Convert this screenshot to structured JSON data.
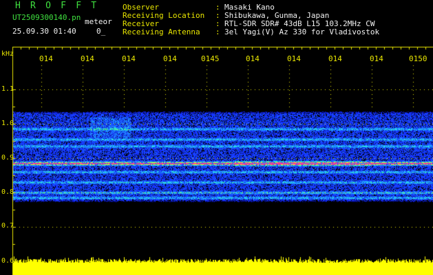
{
  "header": {
    "title": "H R O F F T",
    "file": "UT2509300140.pn",
    "meteor_label": "meteor",
    "date": "25.09.30 01:40",
    "count": "0_",
    "info": [
      {
        "label": "Observer",
        "value": "Masaki Kano"
      },
      {
        "label": "Receiving Location",
        "value": "Shibukawa, Gunma, Japan"
      },
      {
        "label": "Receiver",
        "value": "RTL-SDR SDR# 43dB L15 103.2MHz CW"
      },
      {
        "label": "Receiving Antenna",
        "value": "3el Yagi(V) Az 330 for Vladivostok"
      }
    ]
  },
  "axis": {
    "unit": "kHz",
    "y_ticks": [
      "1.1",
      "1.0",
      "0.9",
      "0.8",
      "0.7",
      "0.6"
    ],
    "x_ticks": [
      "014",
      "014",
      "014",
      "014",
      "0145",
      "014",
      "014",
      "014",
      "014",
      "0150"
    ]
  },
  "spectrogram": {
    "freq_min": 0.77,
    "freq_max": 1.04,
    "lines_khz": [
      0.985,
      0.955,
      0.935,
      0.885,
      0.86,
      0.83,
      0.8,
      0.785
    ],
    "strong_line_khz": 0.885
  },
  "colors": {
    "label": "#3fe03f",
    "text": "#f2f2f2",
    "axis": "#e9e600",
    "noise": "#1535ff",
    "strong": "#ff3399"
  }
}
